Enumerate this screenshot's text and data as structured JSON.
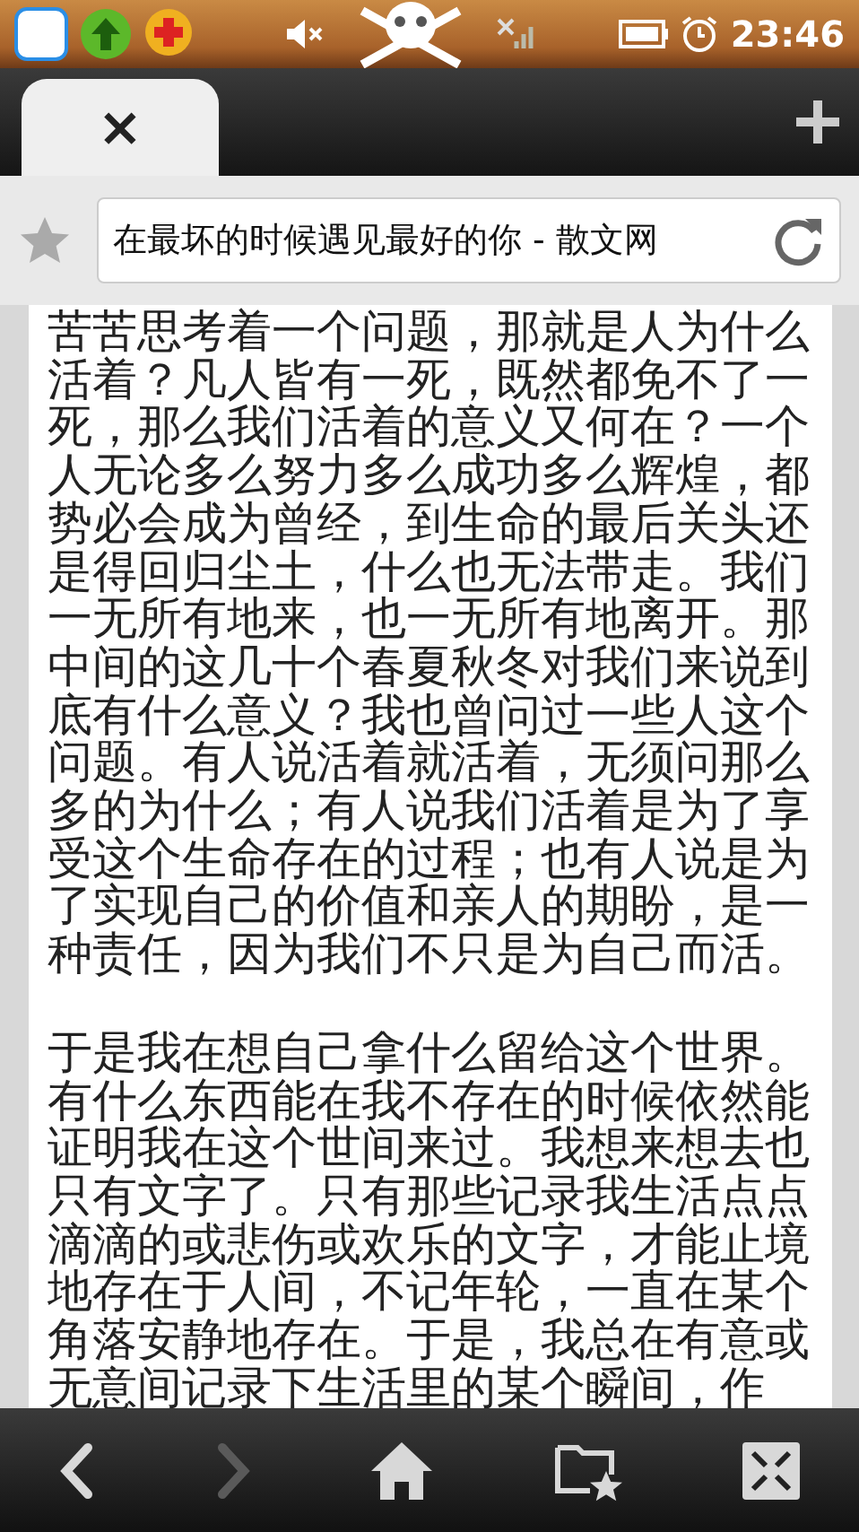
{
  "status_bar": {
    "time": "23:46"
  },
  "tab_bar": {
    "tabs": [
      {
        "close": "×",
        "selected": true
      }
    ]
  },
  "address_bar": {
    "value": "在最坏的时候遇见最好的你 - 散文网"
  },
  "article": {
    "paragraphs": [
      "苦苦思考着一个问题，那就是人为什么活着？凡人皆有一死，既然都免不了一死，那么我们活着的意义又何在？一个人无论多么努力多么成功多么辉煌，都势必会成为曾经，到生命的最后关头还是得回归尘土，什么也无法带走。我们一无所有地来，也一无所有地离开。那中间的这几十个春夏秋冬对我们来说到底有什么意义？我也曾问过一些人这个问题。有人说活着就活着，无须问那么多的为什么；有人说我们活着是为了享受这个生命存在的过程；也有人说是为了实现自己的价值和亲人的期盼，是一种责任，因为我们不只是为自己而活。",
      "于是我在想自己拿什么留给这个世界。有什么东西能在我不存在的时候依然能证明我在这个世间来过。我想来想去也只有文字了。只有那些记录我生活点点滴滴的或悲伤或欢乐的文字，才能止境地存在于人间，不记年轮，一直在某个角落安静地存在。于是，我总在有意或无意间记录下生活里的某个瞬间，作"
    ]
  },
  "toolbar": {
    "buttons": [
      {
        "kind": "back",
        "disabled": false
      },
      {
        "kind": "forward",
        "disabled": true
      },
      {
        "kind": "home",
        "disabled": false
      },
      {
        "kind": "bookmarks",
        "disabled": false
      },
      {
        "kind": "fullscreen",
        "disabled": false
      }
    ]
  }
}
